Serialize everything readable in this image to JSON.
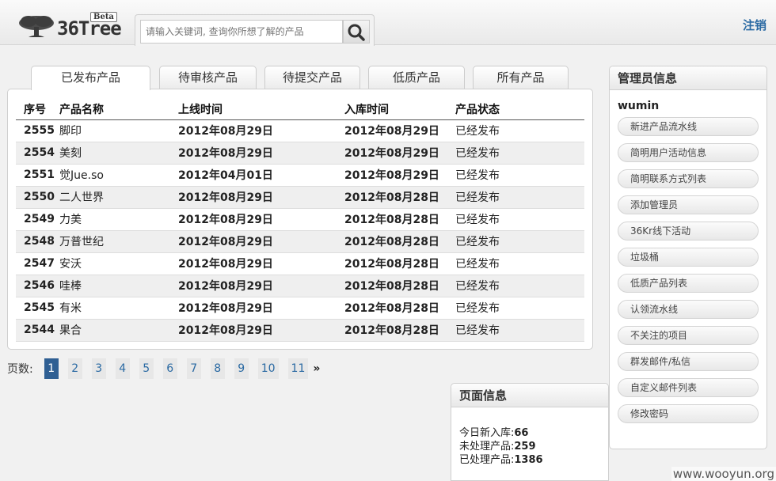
{
  "header": {
    "logo_text": "36Tree",
    "beta_label": "Beta",
    "search_placeholder": "请输入关键词, 查询你所想了解的产品",
    "logout_label": "注销"
  },
  "tabs": [
    {
      "label": "已发布产品",
      "active": true
    },
    {
      "label": "待审核产品",
      "active": false
    },
    {
      "label": "待提交产品",
      "active": false
    },
    {
      "label": "低质产品",
      "active": false
    },
    {
      "label": "所有产品",
      "active": false
    }
  ],
  "table": {
    "headers": [
      "序号",
      "产品名称",
      "上线时间",
      "入库时间",
      "产品状态"
    ],
    "rows": [
      [
        "2555",
        "脚印",
        "2012年08月29日",
        "2012年08月29日",
        "已经发布"
      ],
      [
        "2554",
        "美刻",
        "2012年08月29日",
        "2012年08月29日",
        "已经发布"
      ],
      [
        "2551",
        "觉Jue.so",
        "2012年04月01日",
        "2012年08月29日",
        "已经发布"
      ],
      [
        "2550",
        "二人世界",
        "2012年08月29日",
        "2012年08月28日",
        "已经发布"
      ],
      [
        "2549",
        "力美",
        "2012年08月29日",
        "2012年08月28日",
        "已经发布"
      ],
      [
        "2548",
        "万普世纪",
        "2012年08月29日",
        "2012年08月28日",
        "已经发布"
      ],
      [
        "2547",
        "安沃",
        "2012年08月29日",
        "2012年08月28日",
        "已经发布"
      ],
      [
        "2546",
        "哇棒",
        "2012年08月29日",
        "2012年08月28日",
        "已经发布"
      ],
      [
        "2545",
        "有米",
        "2012年08月29日",
        "2012年08月28日",
        "已经发布"
      ],
      [
        "2544",
        "果合",
        "2012年08月29日",
        "2012年08月28日",
        "已经发布"
      ]
    ]
  },
  "pager": {
    "label": "页数:",
    "pages": [
      "1",
      "2",
      "3",
      "4",
      "5",
      "6",
      "7",
      "8",
      "9",
      "10",
      "11"
    ],
    "current": "1",
    "next": "»"
  },
  "page_info": {
    "title": "页面信息",
    "items": [
      {
        "label": "今日新入库:",
        "value": "66"
      },
      {
        "label": "未处理产品:",
        "value": "259"
      },
      {
        "label": "已处理产品:",
        "value": "1386"
      }
    ]
  },
  "admin": {
    "title": "管理员信息",
    "username": "wumin",
    "links": [
      "新进产品流水线",
      "简明用户活动信息",
      "简明联系方式列表",
      "添加管理员",
      "36Kr线下活动",
      "垃圾桶",
      "低质产品列表",
      "认领流水线",
      "不关注的项目",
      "群发邮件/私信",
      "自定义邮件列表",
      "修改密码"
    ]
  },
  "watermark": "www.wooyun.org",
  "colors": {
    "link": "#2b6aa3",
    "current_page": "#2f5f93"
  }
}
